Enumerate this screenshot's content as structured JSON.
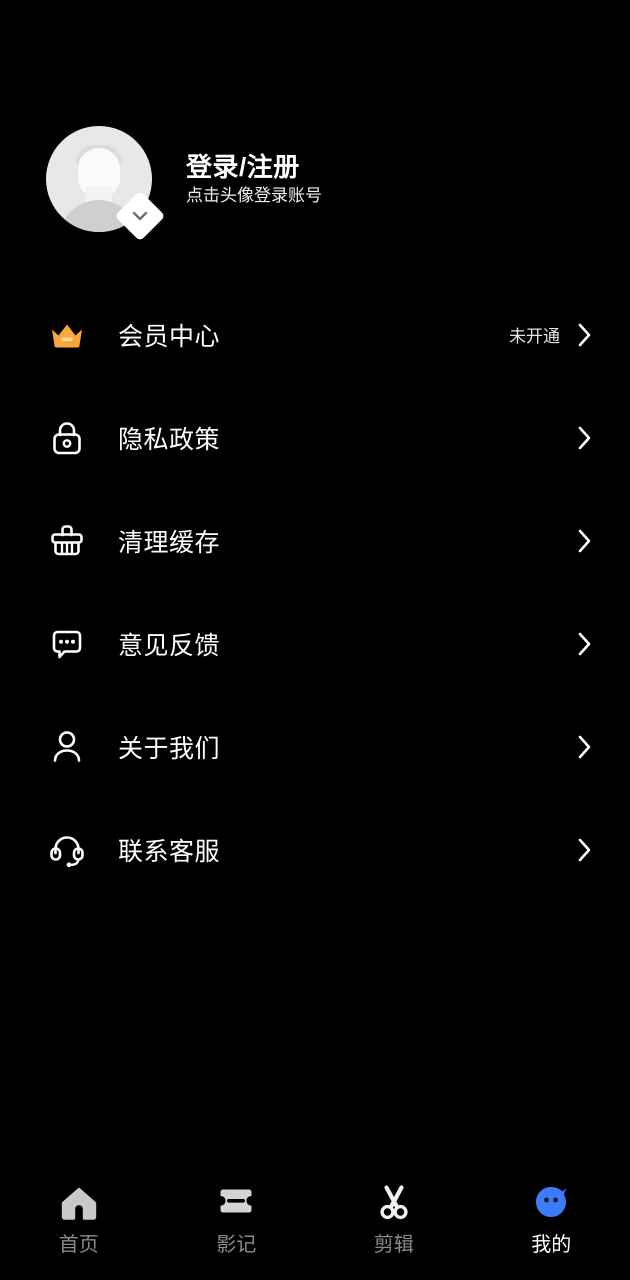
{
  "theme": {
    "background": "#000000",
    "text_primary": "#ffffff",
    "text_secondary": "#8a8a8a",
    "accent_blue": "#3c7cfa",
    "crown_gold": "#f5a623"
  },
  "profile": {
    "title": "登录/注册",
    "subtitle": "点击头像登录账号",
    "avatar_icon": "default-user-avatar",
    "badge_icon": "chevron-down-badge-icon"
  },
  "menu": {
    "items": [
      {
        "id": "member-center",
        "icon": "crown-icon",
        "label": "会员中心",
        "value": "未开通"
      },
      {
        "id": "privacy-policy",
        "icon": "lock-icon",
        "label": "隐私政策",
        "value": ""
      },
      {
        "id": "clear-cache",
        "icon": "broom-icon",
        "label": "清理缓存",
        "value": ""
      },
      {
        "id": "feedback",
        "icon": "comment-icon",
        "label": "意见反馈",
        "value": ""
      },
      {
        "id": "about-us",
        "icon": "person-icon",
        "label": "关于我们",
        "value": ""
      },
      {
        "id": "contact-support",
        "icon": "headset-icon",
        "label": "联系客服",
        "value": ""
      }
    ]
  },
  "tabbar": {
    "items": [
      {
        "id": "home",
        "icon": "home-icon",
        "label": "首页",
        "active": false
      },
      {
        "id": "gallery",
        "icon": "ticket-icon",
        "label": "影记",
        "active": false
      },
      {
        "id": "edit",
        "icon": "scissors-icon",
        "label": "剪辑",
        "active": false
      },
      {
        "id": "mine",
        "icon": "face-icon",
        "label": "我的",
        "active": true
      }
    ]
  }
}
